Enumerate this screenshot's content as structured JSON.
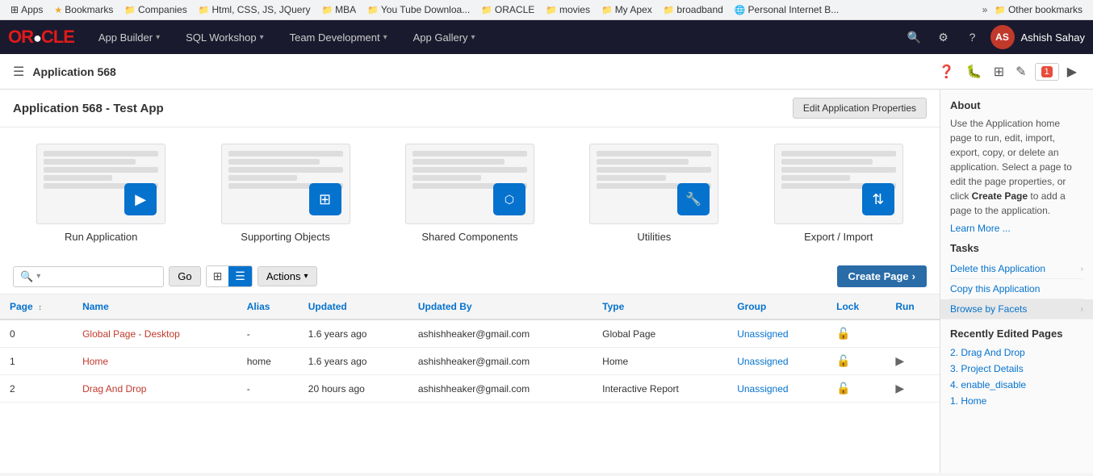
{
  "bookmarks": {
    "items": [
      {
        "label": "Apps",
        "type": "apps",
        "icon": "apps"
      },
      {
        "label": "Bookmarks",
        "type": "star",
        "icon": "star"
      },
      {
        "label": "Companies",
        "type": "folder",
        "icon": "folder"
      },
      {
        "label": "Html, CSS, JS, JQuery",
        "type": "folder",
        "icon": "folder"
      },
      {
        "label": "MBA",
        "type": "folder",
        "icon": "folder"
      },
      {
        "label": "You Tube Downloa...",
        "type": "folder",
        "icon": "folder"
      },
      {
        "label": "ORACLE",
        "type": "folder",
        "icon": "folder"
      },
      {
        "label": "movies",
        "type": "folder",
        "icon": "folder"
      },
      {
        "label": "My Apex",
        "type": "folder",
        "icon": "folder"
      },
      {
        "label": "broadband",
        "type": "folder",
        "icon": "folder"
      },
      {
        "label": "Personal Internet B...",
        "type": "globe",
        "icon": "globe"
      },
      {
        "label": "Other bookmarks",
        "type": "folder",
        "icon": "folder"
      }
    ],
    "overflow_label": "»"
  },
  "header": {
    "logo": "ORACLE",
    "nav": [
      {
        "label": "App Builder",
        "has_dropdown": true
      },
      {
        "label": "SQL Workshop",
        "has_dropdown": true
      },
      {
        "label": "Team Development",
        "has_dropdown": true
      },
      {
        "label": "App Gallery",
        "has_dropdown": true
      }
    ],
    "user_initials": "AS",
    "user_name": "Ashish Sahay"
  },
  "app_bar": {
    "title": "Application 568",
    "icons": [
      "help",
      "debug",
      "shared-components",
      "edit",
      "run"
    ]
  },
  "page_title": "Application 568 - Test App",
  "edit_props_label": "Edit Application Properties",
  "tiles": [
    {
      "label": "Run Application",
      "icon": "▶"
    },
    {
      "label": "Supporting Objects",
      "icon": "⊞"
    },
    {
      "label": "Shared Components",
      "icon": "⬡"
    },
    {
      "label": "Utilities",
      "icon": "🔧"
    },
    {
      "label": "Export / Import",
      "icon": "⇅"
    }
  ],
  "toolbar": {
    "search_placeholder": "",
    "go_label": "Go",
    "actions_label": "Actions",
    "create_page_label": "Create Page"
  },
  "table": {
    "columns": [
      {
        "label": "Page",
        "sortable": true
      },
      {
        "label": "Name"
      },
      {
        "label": "Alias"
      },
      {
        "label": "Updated"
      },
      {
        "label": "Updated By"
      },
      {
        "label": "Type"
      },
      {
        "label": "Group"
      },
      {
        "label": "Lock"
      },
      {
        "label": "Run"
      }
    ],
    "rows": [
      {
        "page": "0",
        "name": "Global Page - Desktop",
        "alias": "-",
        "updated": "1.6 years ago",
        "updated_by": "ashishheaker@gmail.com",
        "type": "Global Page",
        "group": "Unassigned",
        "lock": true,
        "run": false
      },
      {
        "page": "1",
        "name": "Home",
        "alias": "home",
        "updated": "1.6 years ago",
        "updated_by": "ashishheaker@gmail.com",
        "type": "Home",
        "group": "Unassigned",
        "lock": true,
        "run": true
      },
      {
        "page": "2",
        "name": "Drag And Drop",
        "alias": "-",
        "updated": "20 hours ago",
        "updated_by": "ashishheaker@gmail.com",
        "type": "Interactive Report",
        "group": "Unassigned",
        "lock": true,
        "run": true
      }
    ]
  },
  "sidebar": {
    "about_title": "About",
    "about_text": "Use the Application home page to run, edit, import, export, copy, or delete an application. Select a page to edit the page properties, or click",
    "about_bold": "Create Page",
    "about_text2": "to add a page to the application.",
    "learn_more": "Learn More ...",
    "tasks_title": "Tasks",
    "tasks": [
      {
        "label": "Delete this Application",
        "has_sub": true
      },
      {
        "label": "Copy this Application",
        "has_sub": false
      },
      {
        "label": "Browse by Facets",
        "has_sub": true,
        "highlighted": true
      }
    ],
    "recently_edited_title": "Recently Edited Pages",
    "recently_edited": [
      {
        "label": "2. Drag And Drop"
      },
      {
        "label": "3. Project Details"
      },
      {
        "label": "4. enable_disable"
      },
      {
        "label": "1. Home"
      }
    ]
  }
}
